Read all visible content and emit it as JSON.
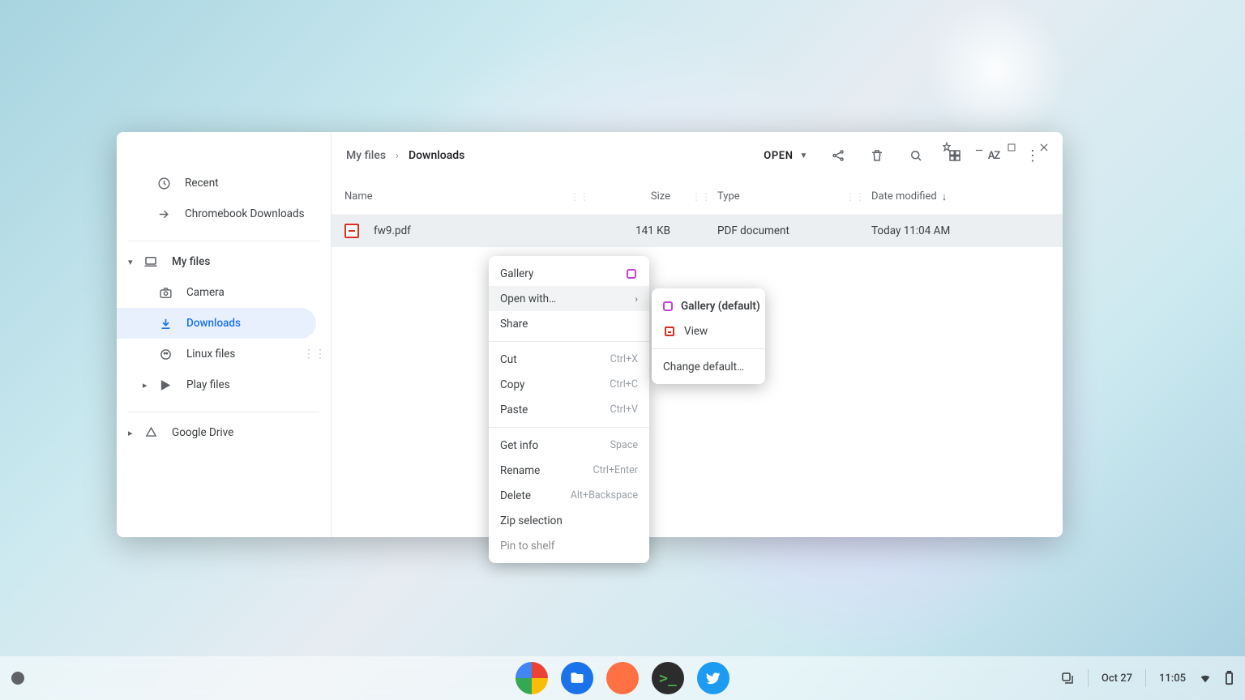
{
  "sidebar": {
    "recent": "Recent",
    "shortcut": "Chromebook Downloads",
    "myfiles": "My files",
    "camera": "Camera",
    "downloads": "Downloads",
    "linux": "Linux files",
    "play": "Play files",
    "drive": "Google Drive"
  },
  "breadcrumb": {
    "root": "My files",
    "current": "Downloads"
  },
  "toolbar": {
    "open": "OPEN"
  },
  "columns": {
    "name": "Name",
    "size": "Size",
    "type": "Type",
    "date": "Date modified"
  },
  "file": {
    "name": "fw9.pdf",
    "size": "141 KB",
    "type": "PDF document",
    "date": "Today 11:04 AM"
  },
  "ctx": {
    "gallery": "Gallery",
    "openwith": "Open with…",
    "share": "Share",
    "cut": "Cut",
    "cut_k": "Ctrl+X",
    "copy": "Copy",
    "copy_k": "Ctrl+C",
    "paste": "Paste",
    "paste_k": "Ctrl+V",
    "getinfo": "Get info",
    "getinfo_k": "Space",
    "rename": "Rename",
    "rename_k": "Ctrl+Enter",
    "delete": "Delete",
    "delete_k": "Alt+Backspace",
    "zip": "Zip selection",
    "pin": "Pin to shelf"
  },
  "sub": {
    "gallery_default": "Gallery (default)",
    "view": "View",
    "change_default": "Change default…"
  },
  "shelf": {
    "date": "Oct 27",
    "time": "11:05"
  }
}
